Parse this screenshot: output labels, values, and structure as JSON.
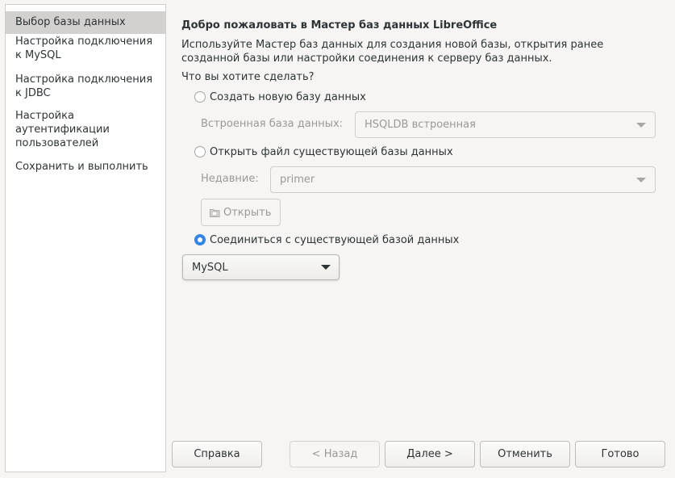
{
  "sidebar": {
    "items": [
      {
        "label": "Выбор базы данных"
      },
      {
        "label": "Настройка подключения к MySQL"
      },
      {
        "label": "Настройка подключения к JDBC"
      },
      {
        "label": "Настройка аутентификации пользователей"
      },
      {
        "label": "Сохранить и выполнить"
      }
    ],
    "selected": "Выбор базы данных"
  },
  "main": {
    "title": "Добро пожаловать в Мастер баз данных LibreOffice",
    "intro": "Используйте Мастер баз данных для создания новой базы, открытия ранее созданной базы или настройки соединения к серверу баз данных.",
    "question": "Что вы хотите сделать?",
    "option_create": {
      "label": "Создать новую базу данных",
      "checked": false
    },
    "embedded_label": "Встроенная база данных:",
    "embedded_value": "HSQLDB встроенная",
    "option_open": {
      "label": "Открыть файл существующей базы данных",
      "checked": false
    },
    "recent_label": "Недавние:",
    "recent_value": "primer",
    "open_button": "Открыть",
    "option_connect": {
      "label": "Соединиться с существующей базой данных",
      "checked": true
    },
    "connection_type": "MySQL"
  },
  "buttons": {
    "help": "Справка",
    "back": "< Назад",
    "next": "Далее >",
    "cancel": "Отменить",
    "finish": "Готово"
  },
  "colors": {
    "accent": "#3584e4",
    "window_bg": "#f6f5f4",
    "sidebar_selected": "#d2d1cf"
  }
}
